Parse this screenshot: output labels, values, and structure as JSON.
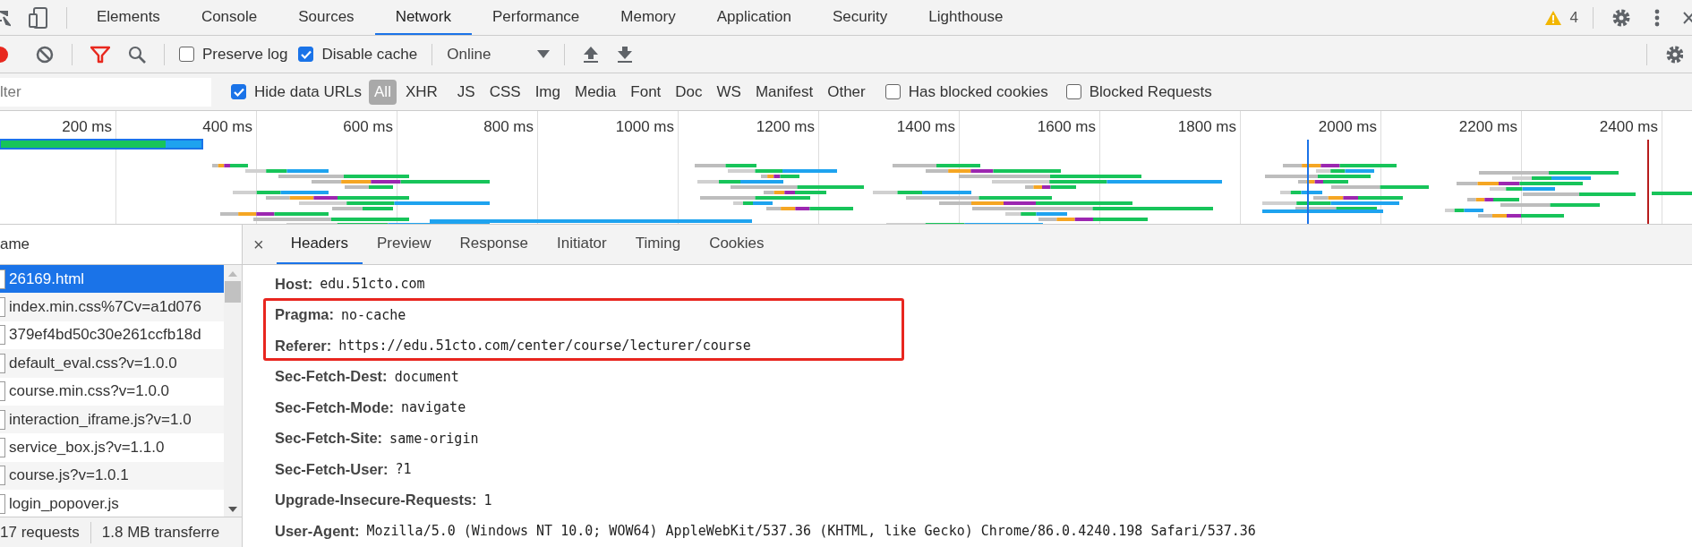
{
  "tabs": [
    {
      "label": "Elements",
      "selected": false
    },
    {
      "label": "Console",
      "selected": false
    },
    {
      "label": "Sources",
      "selected": false
    },
    {
      "label": "Network",
      "selected": true
    },
    {
      "label": "Performance",
      "selected": false
    },
    {
      "label": "Memory",
      "selected": false
    },
    {
      "label": "Application",
      "selected": false
    },
    {
      "label": "Security",
      "selected": false
    },
    {
      "label": "Lighthouse",
      "selected": false
    }
  ],
  "warnings": {
    "count": "4"
  },
  "toolbar": {
    "options": [
      {
        "label": "Preserve log",
        "checked": false
      },
      {
        "label": "Disable cache",
        "checked": true
      }
    ],
    "throttling": "Online"
  },
  "filter_bar": {
    "placeholder": "lter",
    "hide_data_urls": {
      "label": "Hide data URLs",
      "checked": true
    },
    "types": [
      {
        "label": "All",
        "selected": true
      },
      {
        "label": "XHR",
        "selected": false
      },
      {
        "label": "JS",
        "selected": false
      },
      {
        "label": "CSS",
        "selected": false
      },
      {
        "label": "Img",
        "selected": false
      },
      {
        "label": "Media",
        "selected": false
      },
      {
        "label": "Font",
        "selected": false
      },
      {
        "label": "Doc",
        "selected": false
      },
      {
        "label": "WS",
        "selected": false
      },
      {
        "label": "Manifest",
        "selected": false
      },
      {
        "label": "Other",
        "selected": false
      }
    ],
    "options": [
      {
        "label": "Has blocked cookies",
        "checked": false
      },
      {
        "label": "Blocked Requests",
        "checked": false
      }
    ]
  },
  "timeline": {
    "ticks": [
      "200 ms",
      "400 ms",
      "600 ms",
      "800 ms",
      "1000 ms",
      "1200 ms",
      "1400 ms",
      "1600 ms",
      "1800 ms",
      "2000 ms",
      "2200 ms",
      "2400 ms"
    ]
  },
  "requests": {
    "column": "ame",
    "rows": [
      {
        "name": "26169.html",
        "selected": true
      },
      {
        "name": "index.min.css%7Cv=a1d076",
        "selected": false
      },
      {
        "name": "379ef4bd50c30e261ccfb18d",
        "selected": false
      },
      {
        "name": "default_eval.css?v=1.0.0",
        "selected": false
      },
      {
        "name": "course.min.css?v=1.0.0",
        "selected": false
      },
      {
        "name": "interaction_iframe.js?v=1.0",
        "selected": false
      },
      {
        "name": "service_box.js?v=1.1.0",
        "selected": false
      },
      {
        "name": "course.js?v=1.0.1",
        "selected": false
      },
      {
        "name": "login_popover.js",
        "selected": false
      }
    ]
  },
  "status_bar": {
    "requests": "17 requests",
    "transferred": "1.8 MB transferre"
  },
  "detail": {
    "close": "×",
    "tabs": [
      {
        "label": "Headers",
        "selected": true
      },
      {
        "label": "Preview",
        "selected": false
      },
      {
        "label": "Response",
        "selected": false
      },
      {
        "label": "Initiator",
        "selected": false
      },
      {
        "label": "Timing",
        "selected": false
      },
      {
        "label": "Cookies",
        "selected": false
      }
    ],
    "headers": [
      {
        "name": "Host:",
        "value": "edu.51cto.com"
      },
      {
        "name": "Pragma:",
        "value": "no-cache"
      },
      {
        "name": "Referer:",
        "value": "https://edu.51cto.com/center/course/lecturer/course"
      },
      {
        "name": "Sec-Fetch-Dest:",
        "value": "document"
      },
      {
        "name": "Sec-Fetch-Mode:",
        "value": "navigate"
      },
      {
        "name": "Sec-Fetch-Site:",
        "value": "same-origin"
      },
      {
        "name": "Sec-Fetch-User:",
        "value": "?1"
      },
      {
        "name": "Upgrade-Insecure-Requests:",
        "value": "1"
      },
      {
        "name": "User-Agent:",
        "value": "Mozilla/5.0 (Windows NT 10.0; WOW64) AppleWebKit/537.36 (KHTML, like Gecko) Chrome/86.0.4240.198 Safari/537.36"
      }
    ]
  }
}
